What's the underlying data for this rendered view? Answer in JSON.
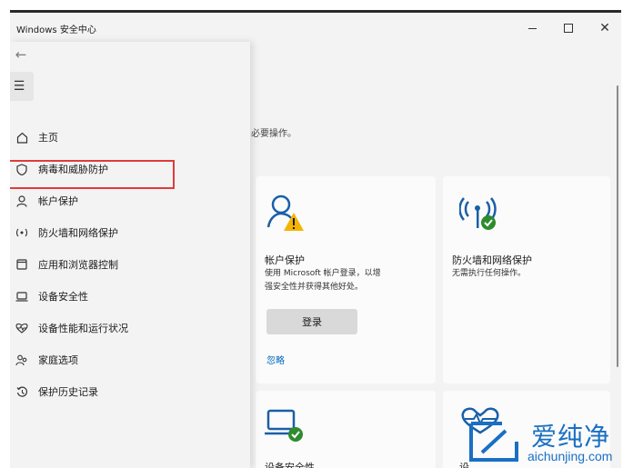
{
  "window": {
    "title": "Windows 安全中心"
  },
  "main": {
    "subtext": "必要操作。",
    "cards": [
      {
        "title": "帐户保护",
        "desc_lines": [
          "使用 Microsoft 帐户登录，以增",
          "强安全性并获得其他好处。"
        ],
        "button_label": "登录",
        "link_label": "忽略",
        "icon": "account-warning-icon"
      },
      {
        "title": "防火墙和网络保护",
        "desc_lines": [
          "无需执行任何操作。"
        ],
        "icon": "wifi-check-icon"
      },
      {
        "title": "设备安全性",
        "icon": "laptop-check-icon"
      },
      {
        "title": "设",
        "icon": "heart-rate-icon"
      }
    ]
  },
  "nav": {
    "items": [
      {
        "label": "主页",
        "icon": "home-icon"
      },
      {
        "label": "病毒和威胁防护",
        "icon": "shield-icon"
      },
      {
        "label": "帐户保护",
        "icon": "person-icon"
      },
      {
        "label": "防火墙和网络保护",
        "icon": "wifi-icon"
      },
      {
        "label": "应用和浏览器控制",
        "icon": "browser-window-icon"
      },
      {
        "label": "设备安全性",
        "icon": "laptop-icon"
      },
      {
        "label": "设备性能和运行状况",
        "icon": "heart-icon"
      },
      {
        "label": "家庭选项",
        "icon": "family-icon"
      },
      {
        "label": "保护历史记录",
        "icon": "history-icon"
      }
    ]
  },
  "watermark": {
    "cn": "爱纯净",
    "en": "aichunjing.com"
  },
  "colors": {
    "accent": "#0067c0",
    "success": "#2e8b2e",
    "warning": "#f5b400",
    "highlight": "#e03b3b",
    "watermark": "#1a6fc3"
  }
}
